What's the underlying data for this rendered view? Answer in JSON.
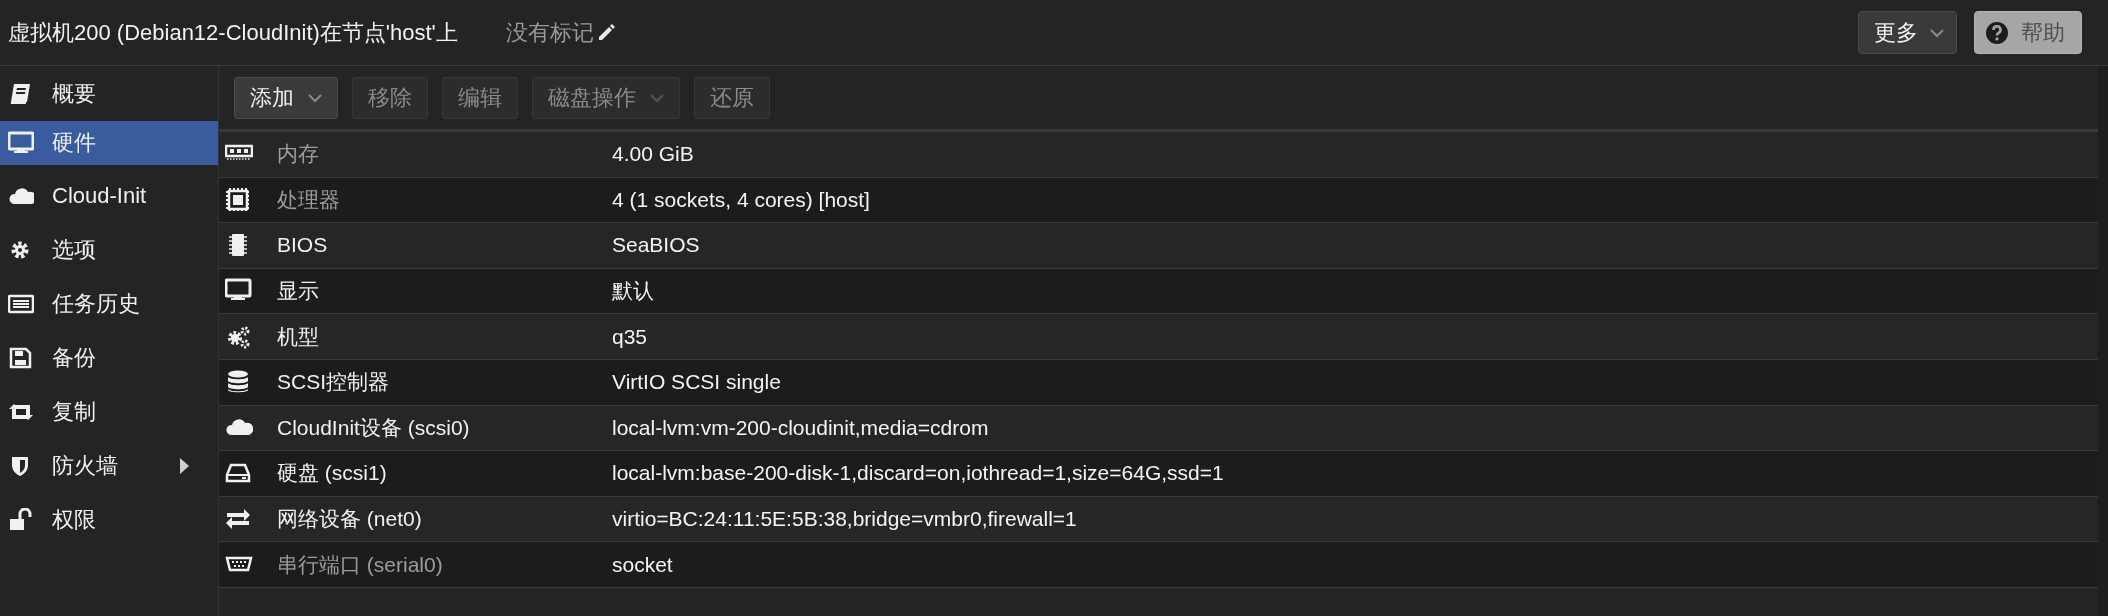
{
  "header": {
    "title": "虚拟机200 (Debian12-CloudInit)在节点'host'上",
    "tags": "没有标记",
    "buttons": [
      {
        "label": "更多",
        "kind": "menu",
        "disabled": false
      },
      {
        "label": "帮助",
        "kind": "help",
        "disabled": false
      }
    ]
  },
  "sidebar": {
    "items": [
      {
        "label": "概要",
        "selected": false
      },
      {
        "label": "硬件",
        "selected": true
      },
      {
        "label": "Cloud-Init",
        "selected": false
      },
      {
        "label": "选项",
        "selected": false
      },
      {
        "label": "任务历史",
        "selected": false
      },
      {
        "label": "备份",
        "selected": false
      },
      {
        "label": "复制",
        "selected": false
      },
      {
        "label": "防火墙",
        "selected": false,
        "expanded": false
      },
      {
        "label": "权限",
        "selected": false
      }
    ]
  },
  "toolbar": {
    "buttons": [
      {
        "label": "添加",
        "menu": true,
        "disabled": false
      },
      {
        "label": "移除",
        "menu": false,
        "disabled": true
      },
      {
        "label": "编辑",
        "menu": false,
        "disabled": true
      },
      {
        "label": "磁盘操作",
        "menu": true,
        "disabled": true
      },
      {
        "label": "还原",
        "menu": false,
        "disabled": true
      }
    ]
  },
  "table": {
    "rows": [
      {
        "name": "内存",
        "value": "4.00 GiB",
        "dimmed": true
      },
      {
        "name": "处理器",
        "value": "4 (1 sockets, 4 cores) [host]",
        "dimmed": true
      },
      {
        "name": "BIOS",
        "value": "SeaBIOS",
        "dimmed": false
      },
      {
        "name": "显示",
        "value": "默认",
        "dimmed": false
      },
      {
        "name": "机型",
        "value": "q35",
        "dimmed": false
      },
      {
        "name": "SCSI控制器",
        "value": "VirtIO SCSI single",
        "dimmed": false
      },
      {
        "name": "CloudInit设备 (scsi0)",
        "value": "local-lvm:vm-200-cloudinit,media=cdrom",
        "dimmed": false
      },
      {
        "name": "硬盘 (scsi1)",
        "value": "local-lvm:base-200-disk-1,discard=on,iothread=1,size=64G,ssd=1",
        "dimmed": false
      },
      {
        "name": "网络设备 (net0)",
        "value": "virtio=BC:24:11:5E:5B:38,bridge=vmbr0,firewall=1",
        "dimmed": false
      },
      {
        "name": "串行端口 (serial0)",
        "value": "socket",
        "dimmed": true
      }
    ]
  }
}
